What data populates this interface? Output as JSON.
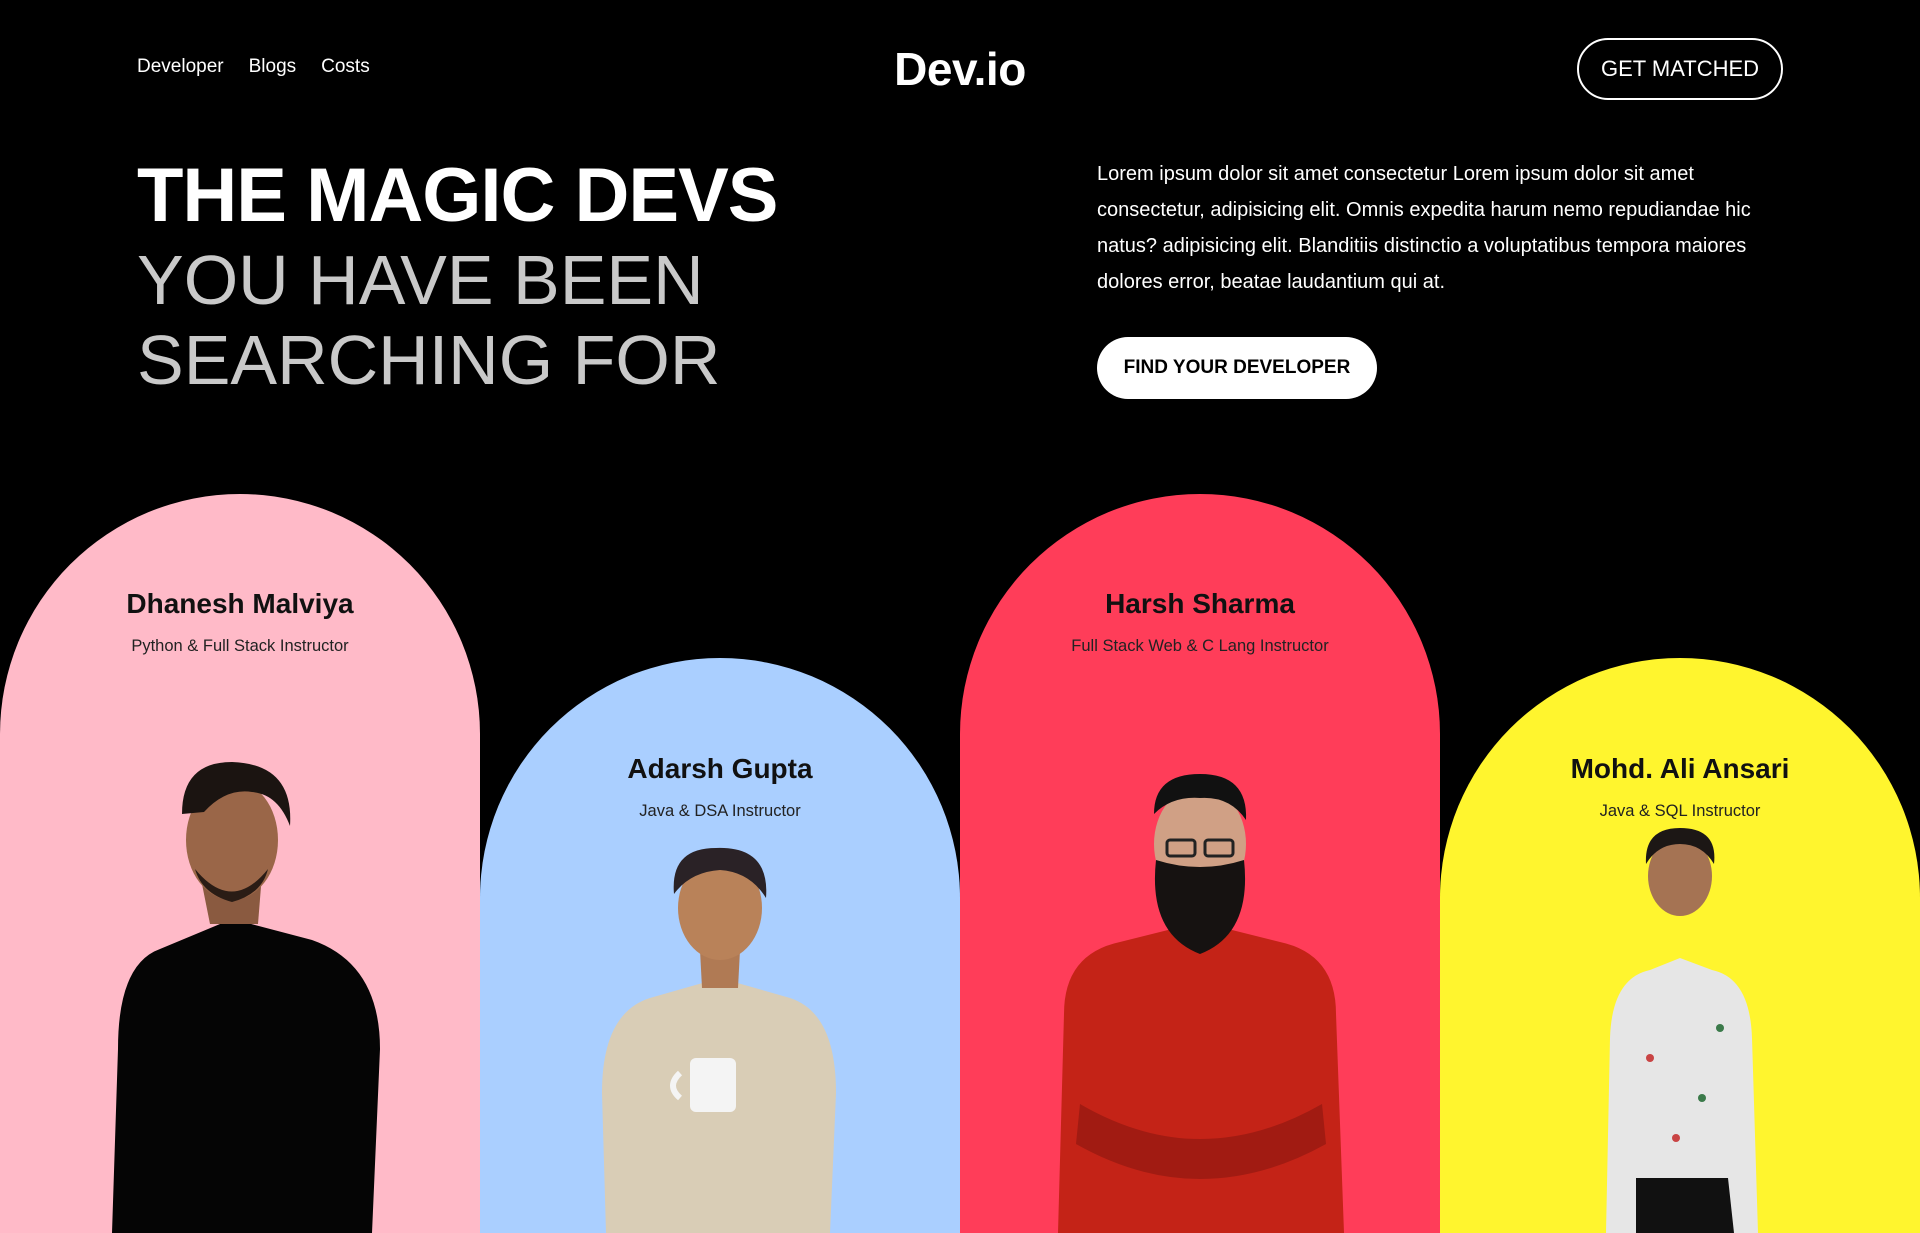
{
  "nav": {
    "links": [
      "Developer",
      "Blogs",
      "Costs"
    ],
    "logo": "Dev.io",
    "cta": "GET MATCHED"
  },
  "hero": {
    "title_line1": "THE MAGIC DEVS",
    "title_line2": "YOU HAVE BEEN",
    "title_line3": "SEARCHING FOR",
    "description": "Lorem ipsum dolor sit amet consectetur Lorem ipsum dolor sit amet consectetur, adipisicing elit. Omnis expedita harum nemo repudiandae hic natus? adipisicing elit. Blanditiis distinctio a voluptatibus tempora maiores dolores error, beatae laudantium qui at.",
    "button": "FIND YOUR DEVELOPER"
  },
  "developers": [
    {
      "name": "Dhanesh Malviya",
      "role": "Python & Full Stack Instructor",
      "color": "#ffbac8"
    },
    {
      "name": "Adarsh Gupta",
      "role": "Java & DSA Instructor",
      "color": "#aacfff"
    },
    {
      "name": "Harsh Sharma",
      "role": "Full Stack Web & C Lang Instructor",
      "color": "#ff3d59"
    },
    {
      "name": "Mohd. Ali Ansari",
      "role": "Java & SQL Instructor",
      "color": "#fff52e"
    }
  ]
}
